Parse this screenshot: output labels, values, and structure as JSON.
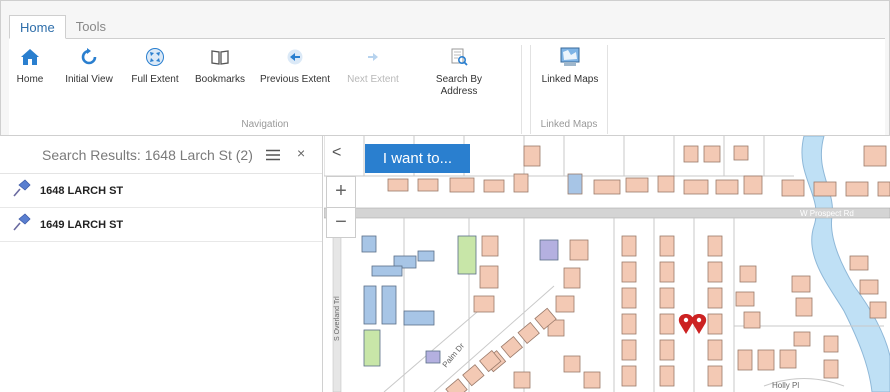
{
  "tabs": [
    {
      "label": "Home",
      "active": true
    },
    {
      "label": "Tools",
      "active": false
    }
  ],
  "toolbar": {
    "navigation": {
      "group_label": "Navigation",
      "home": "Home",
      "initial_view": "Initial View",
      "full_extent": "Full Extent",
      "bookmarks": "Bookmarks",
      "previous_extent": "Previous Extent",
      "next_extent": "Next Extent",
      "search_by_address_line1": "Search By",
      "search_by_address_line2": "Address"
    },
    "linked_maps": {
      "group_label": "Linked Maps",
      "linked_maps": "Linked Maps"
    }
  },
  "panel": {
    "title": "Search Results: 1648 Larch St (2)",
    "close": "×",
    "results": [
      {
        "label": "1648 LARCH ST"
      },
      {
        "label": "1649 LARCH ST"
      }
    ]
  },
  "map": {
    "collapse": "<",
    "i_want_to": "I want to...",
    "zoom_in": "+",
    "zoom_out": "−",
    "streets": {
      "prospect": "W Prospect Rd",
      "overland": "S Overland Trl",
      "palm": "Palm Dr",
      "holly": "Holly Pl"
    }
  },
  "colors": {
    "accent": "#2a7fcf",
    "parcel": "#f3c9b4",
    "parcel_stroke": "#9a7a6a",
    "water": "#bfe0f5",
    "building_blue": "#a7c5e6",
    "building_green": "#c8e6a8",
    "building_purple": "#b4b0e0",
    "marker": "#cc2222"
  },
  "icons": {
    "home": "home-icon",
    "initial_view": "refresh-icon",
    "full_extent": "expand-icon",
    "bookmarks": "book-icon",
    "previous_extent": "back-arrow-icon",
    "next_extent": "forward-arrow-icon",
    "search_by_address": "search-doc-icon",
    "linked_maps": "linked-maps-icon",
    "result_pin": "pushpin-icon"
  }
}
